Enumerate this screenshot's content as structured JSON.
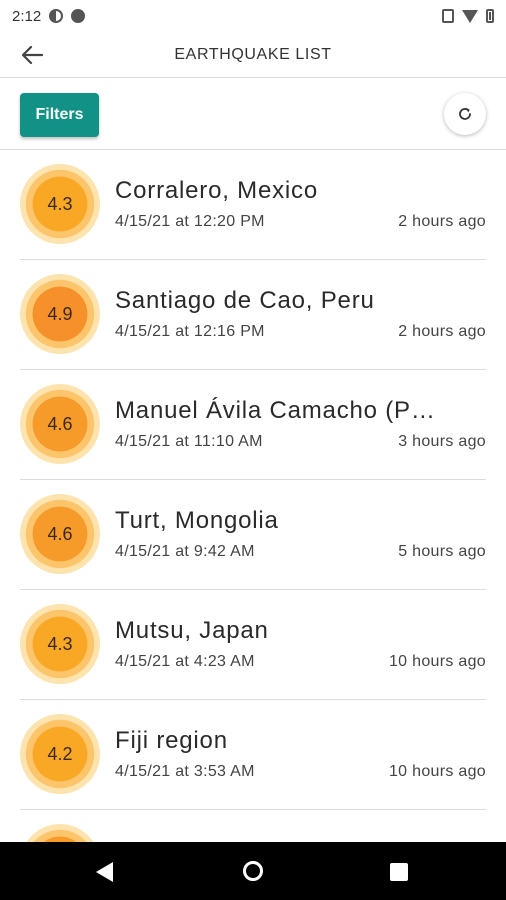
{
  "status_bar": {
    "time": "2:12"
  },
  "app_bar": {
    "title": "EARTHQUAKE LIST",
    "back_icon": "arrow-left-icon"
  },
  "toolbar": {
    "filters_label": "Filters",
    "filters_color": "#129187",
    "refresh_icon": "refresh-icon"
  },
  "colors": {
    "mag_fill_low": "#f9a825",
    "mag_fill_high": "#f5902a",
    "ring_inner": "#fcc56b",
    "ring_outer": "#fde3ad"
  },
  "earthquakes": [
    {
      "magnitude": "4.3",
      "place": "Corralero, Mexico",
      "datetime": "4/15/21 at 12:20 PM",
      "relative": "2 hours ago",
      "color": "#f9a825"
    },
    {
      "magnitude": "4.9",
      "place": "Santiago de Cao, Peru",
      "datetime": "4/15/21 at 12:16 PM",
      "relative": "2 hours ago",
      "color": "#f5902a"
    },
    {
      "magnitude": "4.6",
      "place": "Manuel Ávila Camacho (P…",
      "datetime": "4/15/21 at 11:10 AM",
      "relative": "3 hours ago",
      "color": "#f69a2a"
    },
    {
      "magnitude": "4.6",
      "place": "Turt, Mongolia",
      "datetime": "4/15/21 at 9:42 AM",
      "relative": "5 hours ago",
      "color": "#f69a2a"
    },
    {
      "magnitude": "4.3",
      "place": "Mutsu, Japan",
      "datetime": "4/15/21 at 4:23 AM",
      "relative": "10 hours ago",
      "color": "#f9a825"
    },
    {
      "magnitude": "4.2",
      "place": "Fiji region",
      "datetime": "4/15/21 at 3:53 AM",
      "relative": "10 hours ago",
      "color": "#f9a825"
    },
    {
      "magnitude": "",
      "place": "",
      "datetime": "",
      "relative": "",
      "color": "#f69a2a"
    }
  ]
}
